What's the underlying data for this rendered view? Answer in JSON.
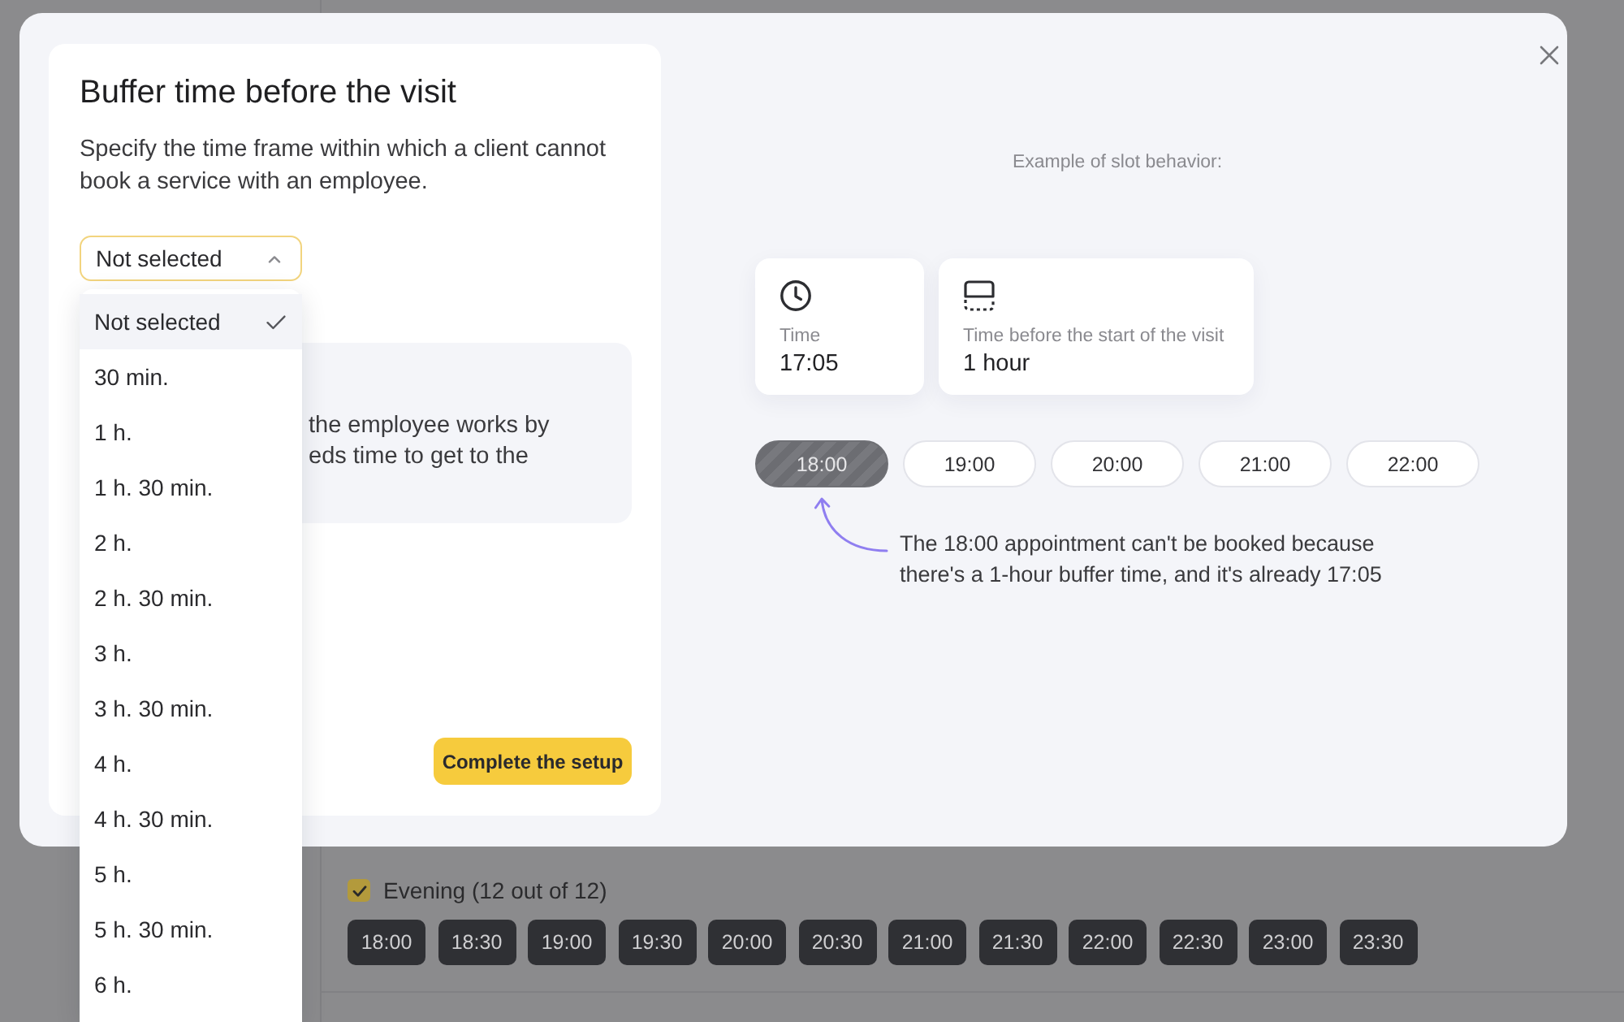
{
  "background": {
    "section": {
      "label": "Evening (12 out of 12)",
      "checked": true,
      "slots": [
        "18:00",
        "18:30",
        "19:00",
        "19:30",
        "20:00",
        "20:30",
        "21:00",
        "21:30",
        "22:00",
        "22:30",
        "23:00",
        "23:30"
      ]
    }
  },
  "modal": {
    "title": "Buffer time before the visit",
    "description": "Specify the time frame within which a client cannot book a service with an employee.",
    "select": {
      "value": "Not selected",
      "expanded": true,
      "options": [
        {
          "label": "Not selected",
          "selected": true
        },
        {
          "label": "30 min.",
          "selected": false
        },
        {
          "label": "1 h.",
          "selected": false
        },
        {
          "label": "1 h. 30 min.",
          "selected": false
        },
        {
          "label": "2 h.",
          "selected": false
        },
        {
          "label": "2 h. 30 min.",
          "selected": false
        },
        {
          "label": "3 h.",
          "selected": false
        },
        {
          "label": "3 h. 30 min.",
          "selected": false
        },
        {
          "label": "4 h.",
          "selected": false
        },
        {
          "label": "4 h. 30 min.",
          "selected": false
        },
        {
          "label": "5 h.",
          "selected": false
        },
        {
          "label": "5 h. 30 min.",
          "selected": false
        },
        {
          "label": "6 h.",
          "selected": false
        }
      ]
    },
    "info_card": {
      "text": "the employee works by\neds time to get to the"
    },
    "primary_button": "Complete the setup",
    "example": {
      "caption": "Example of slot behavior:",
      "cards": [
        {
          "kind": "clock",
          "label": "Time",
          "value": "17:05"
        },
        {
          "kind": "buffer",
          "label": "Time before the start of the visit",
          "value": "1 hour"
        }
      ],
      "slots": [
        {
          "time": "18:00",
          "blocked": true
        },
        {
          "time": "19:00",
          "blocked": false
        },
        {
          "time": "20:00",
          "blocked": false
        },
        {
          "time": "21:00",
          "blocked": false
        },
        {
          "time": "22:00",
          "blocked": false
        }
      ],
      "annotation": "The 18:00 appointment can't be booked because there's a 1-hour buffer time, and it's already 17:05"
    }
  }
}
